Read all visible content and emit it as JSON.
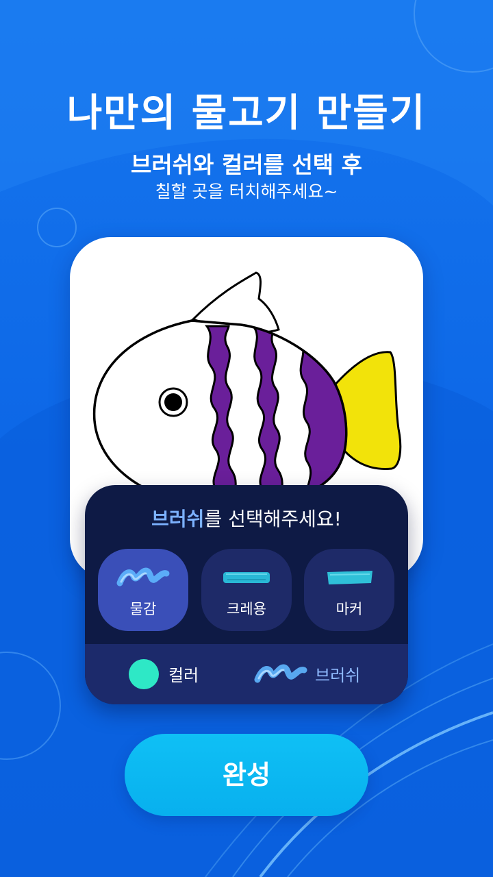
{
  "header": {
    "title": "나만의 물고기 만들기",
    "subtitle": "브러쉬와 컬러를 선택 후",
    "instruction": "칠할 곳을 터치해주세요~"
  },
  "canvas": {
    "subject": "fish",
    "colors": {
      "stripes": "#6a1f9a",
      "tail": "#f2e30a",
      "outline": "#000000"
    }
  },
  "brush_panel": {
    "prompt_highlight": "브러쉬",
    "prompt_rest": "를 선택해주세요!",
    "brushes": [
      {
        "label": "물감",
        "icon": "watercolor-stroke-icon",
        "selected": true
      },
      {
        "label": "크레용",
        "icon": "crayon-stroke-icon",
        "selected": false
      },
      {
        "label": "마커",
        "icon": "marker-stroke-icon",
        "selected": false
      }
    ],
    "current_color_label": "컬러",
    "current_color": "#2ee8c6",
    "current_brush_label": "브러쉬"
  },
  "done_button": {
    "label": "완성"
  },
  "theme": {
    "background": "#0c66e6",
    "panel": "#0e1a45",
    "accent": "#08b0ee"
  }
}
